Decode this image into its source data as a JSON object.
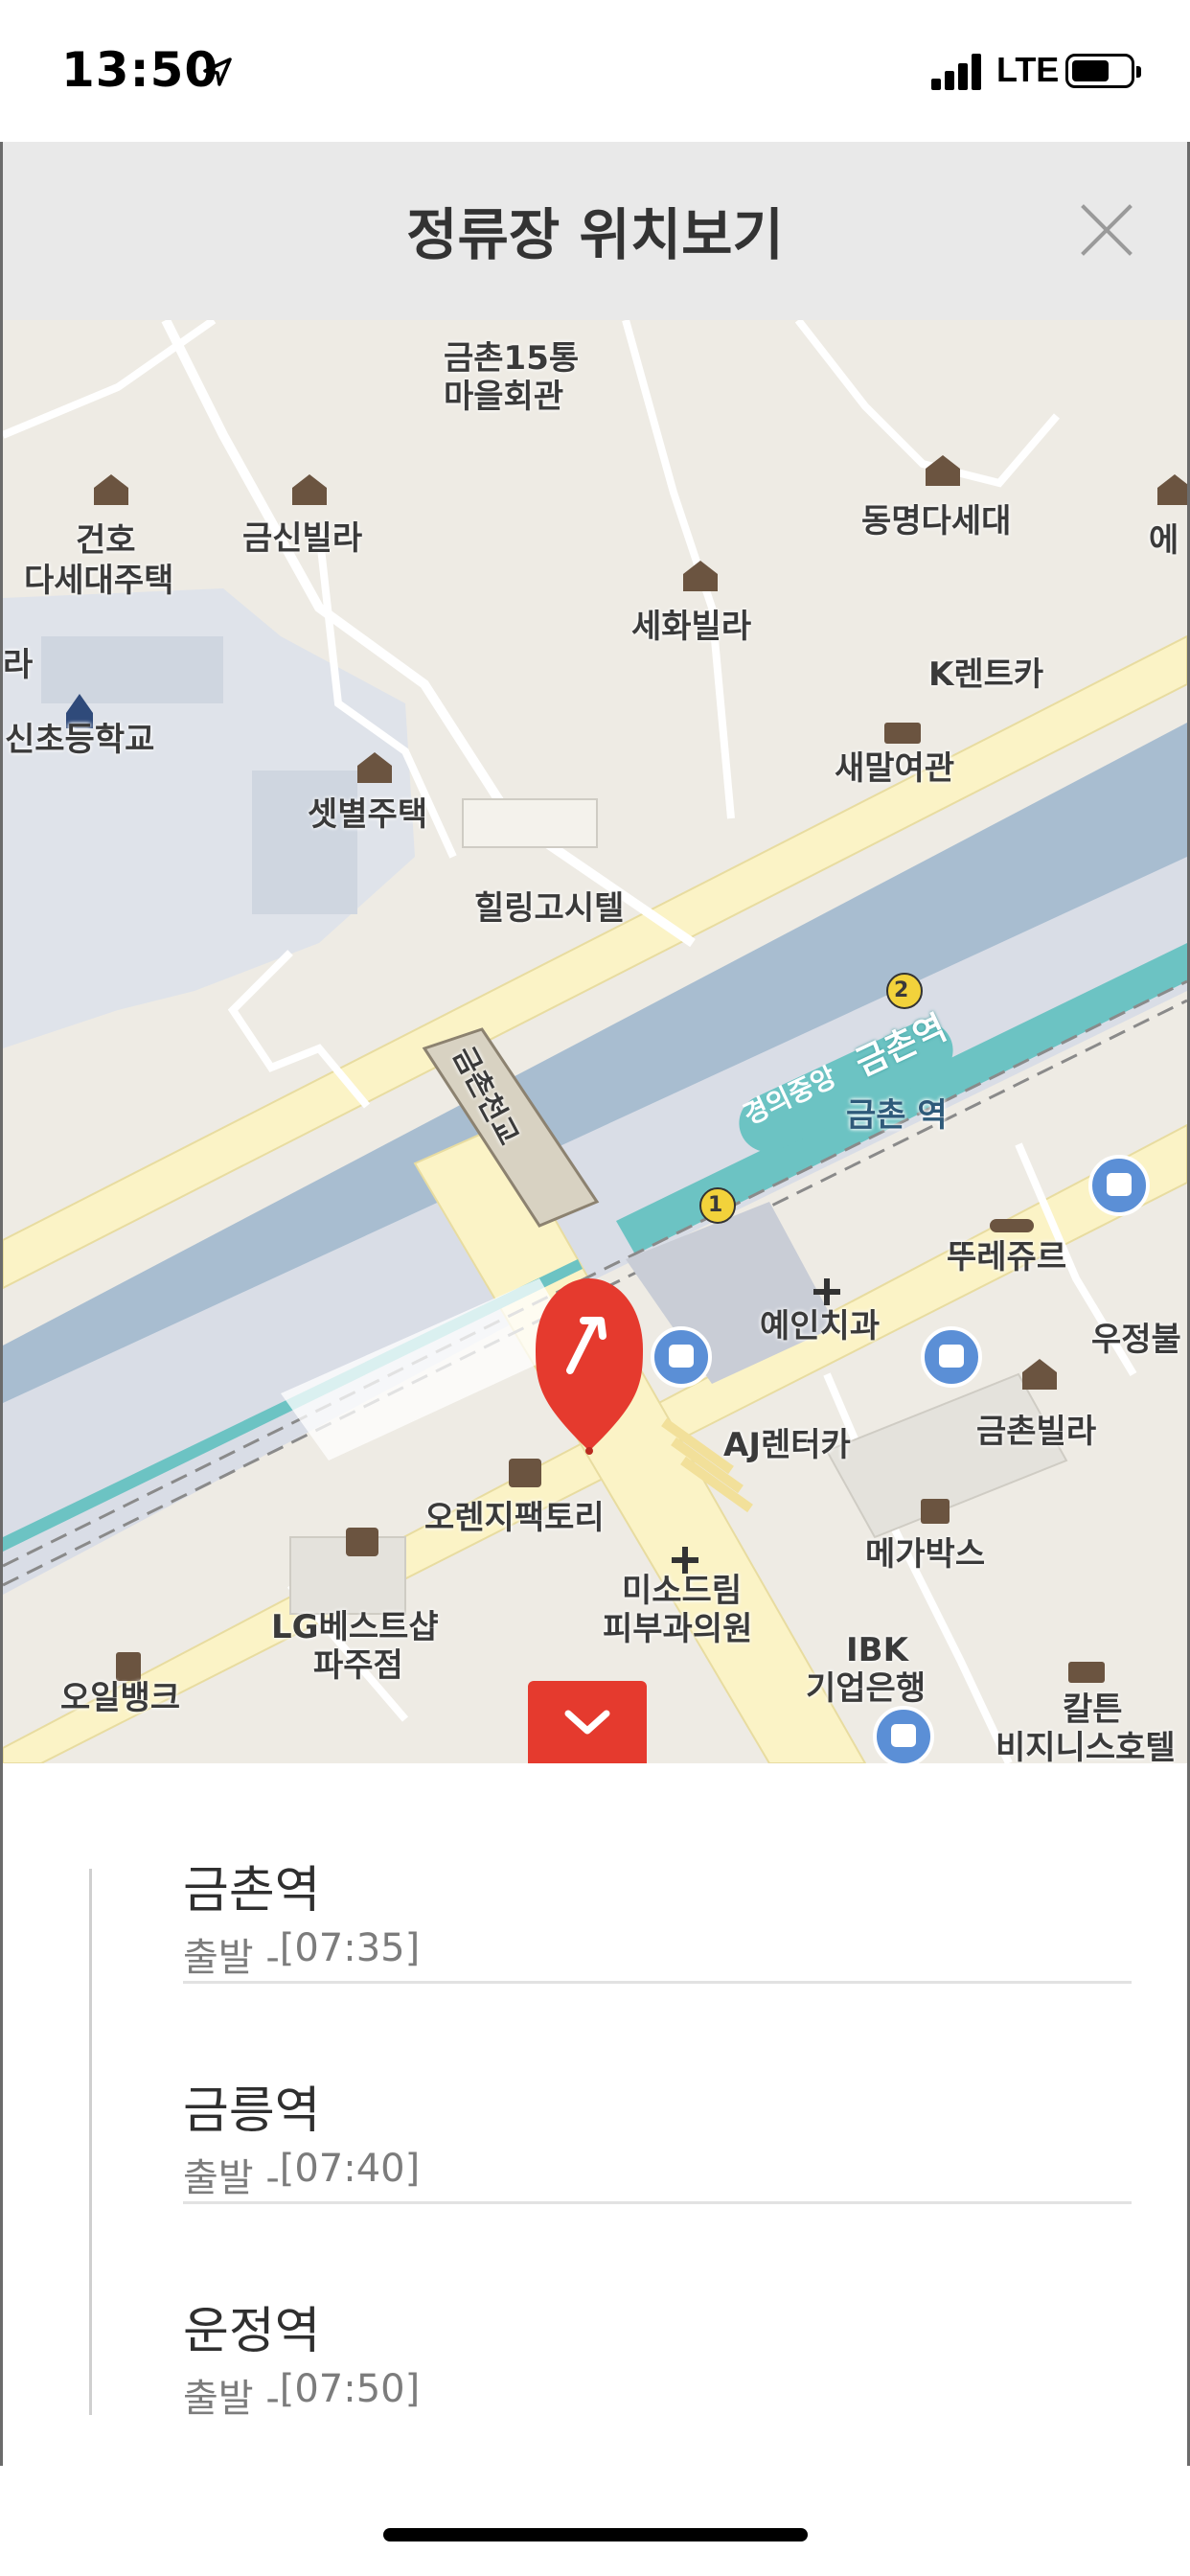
{
  "status_bar": {
    "time": "13:50",
    "network": "LTE",
    "battery_level_pct": 65
  },
  "header": {
    "title": "정류장 위치보기"
  },
  "map": {
    "labels": {
      "geumchon15": "금촌15통",
      "maeulhall": "마을회관",
      "geonho": "건호",
      "dasedae_jutaek": "다세대주택",
      "geumsin_villa": "금신빌라",
      "dongmyeong": "동명다세대",
      "e_partial": "에",
      "sehwa_villa": "세화빌라",
      "k_rentcar": "K렌트카",
      "ra_partial": "라",
      "sincho_school": "신초등학교",
      "saemal_inn": "새말여관",
      "setbyeol": "셋별주택",
      "healing_hotel": "힐링고시텔",
      "geumchon_bridge": "금촌천교",
      "gyeongui_line": "경의중앙",
      "geumchon_station_big": "금촌역",
      "geumchon_station": "금촌 역",
      "exit_2": "2",
      "exit_1": "1",
      "tourjours": "뚜레쥬르",
      "yein_dental": "예인치과",
      "ujeong_partial": "우정불",
      "geumchon_villa": "금촌빌라",
      "aj_rentcar": "AJ렌터카",
      "orange_factory": "오렌지팩토리",
      "megabox": "메가박스",
      "misodream": "미소드림",
      "skin_clinic": "피부과의원",
      "lg_best": "LG베스트샵",
      "paju_branch": "파주점",
      "ibk": "IBK",
      "ibk_bank": "기업은행",
      "oilbank": "오일뱅크",
      "calton": "칼튼",
      "business_hotel": "비지니스호텔"
    }
  },
  "stops": [
    {
      "name": "금촌역",
      "departure_label": "출발 - ",
      "time": "[07:35]"
    },
    {
      "name": "금릉역",
      "departure_label": "출발 - ",
      "time": "[07:40]"
    },
    {
      "name": "운정역",
      "departure_label": "출발 - ",
      "time": "[07:50]"
    }
  ],
  "colors": {
    "accent": "#e53a2e",
    "river": "#9fb4c8",
    "road": "#fbf3c6",
    "rail": "#6cc3c3",
    "bus": "#5b8fd6"
  }
}
